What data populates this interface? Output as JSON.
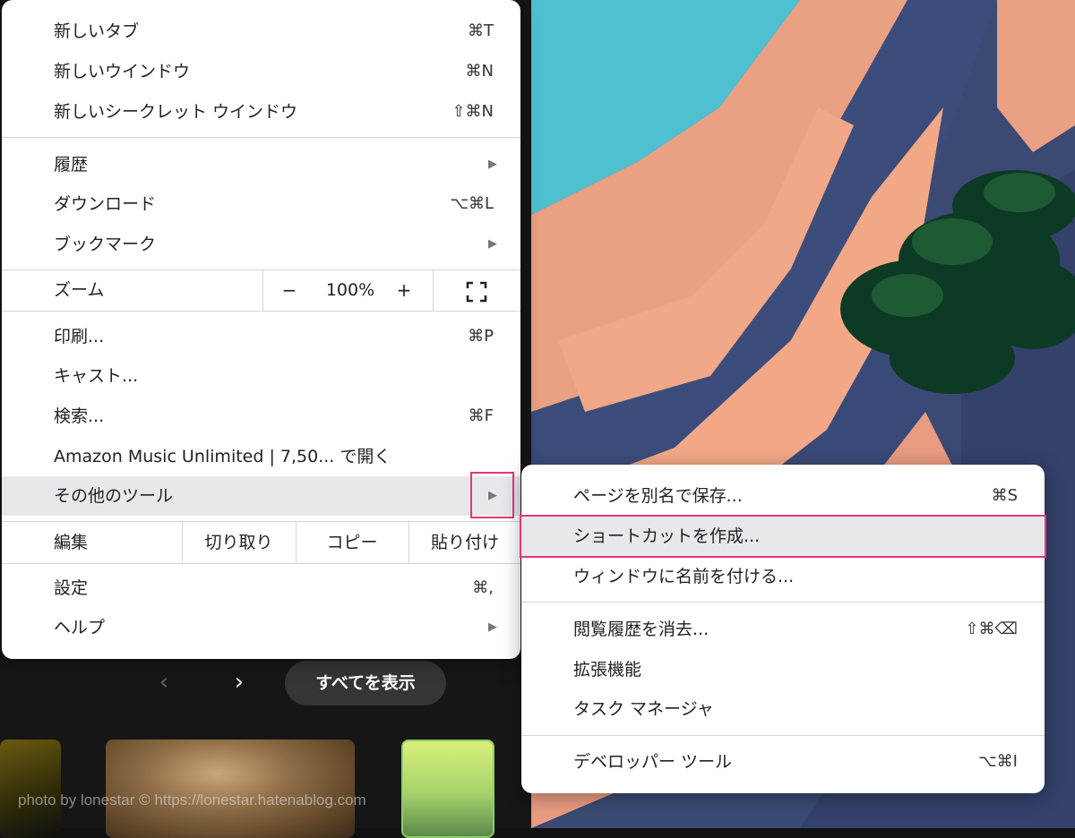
{
  "main_menu": {
    "new_tab": {
      "label": "新しいタブ",
      "shortcut": "⌘T"
    },
    "new_window": {
      "label": "新しいウインドウ",
      "shortcut": "⌘N"
    },
    "new_incognito": {
      "label": "新しいシークレット ウインドウ",
      "shortcut": "⇧⌘N"
    },
    "history": {
      "label": "履歴"
    },
    "downloads": {
      "label": "ダウンロード",
      "shortcut": "⌥⌘L"
    },
    "bookmarks": {
      "label": "ブックマーク"
    },
    "zoom": {
      "label": "ズーム",
      "minus": "−",
      "value": "100%",
      "plus": "+"
    },
    "print": {
      "label": "印刷...",
      "shortcut": "⌘P"
    },
    "cast": {
      "label": "キャスト..."
    },
    "find": {
      "label": "検索...",
      "shortcut": "⌘F"
    },
    "open_in_app": {
      "label": "Amazon Music Unlimited | 7,50... で開く"
    },
    "more_tools": {
      "label": "その他のツール"
    },
    "edit": {
      "label": "編集",
      "cut": "切り取り",
      "copy": "コピー",
      "paste": "貼り付け"
    },
    "settings": {
      "label": "設定",
      "shortcut": "⌘,"
    },
    "help": {
      "label": "ヘルプ"
    }
  },
  "sub_menu": {
    "save_page": {
      "label": "ページを別名で保存...",
      "shortcut": "⌘S"
    },
    "create_shortcut": {
      "label": "ショートカットを作成..."
    },
    "name_window": {
      "label": "ウィンドウに名前を付ける..."
    },
    "clear_data": {
      "label": "閲覧履歴を消去...",
      "shortcut": "⇧⌘⌫"
    },
    "extensions": {
      "label": "拡張機能"
    },
    "task_manager": {
      "label": "タスク マネージャ"
    },
    "devtools": {
      "label": "デベロッパー ツール",
      "shortcut": "⌥⌘I"
    }
  },
  "page": {
    "prev": "‹",
    "next": "›",
    "show_all": "すべてを表示"
  },
  "watermark": "photo by lonestar © https://lonestar.hatenablog.com",
  "colors": {
    "highlight_box": "#e8357a",
    "menu_hover": "#e8e8ec"
  }
}
